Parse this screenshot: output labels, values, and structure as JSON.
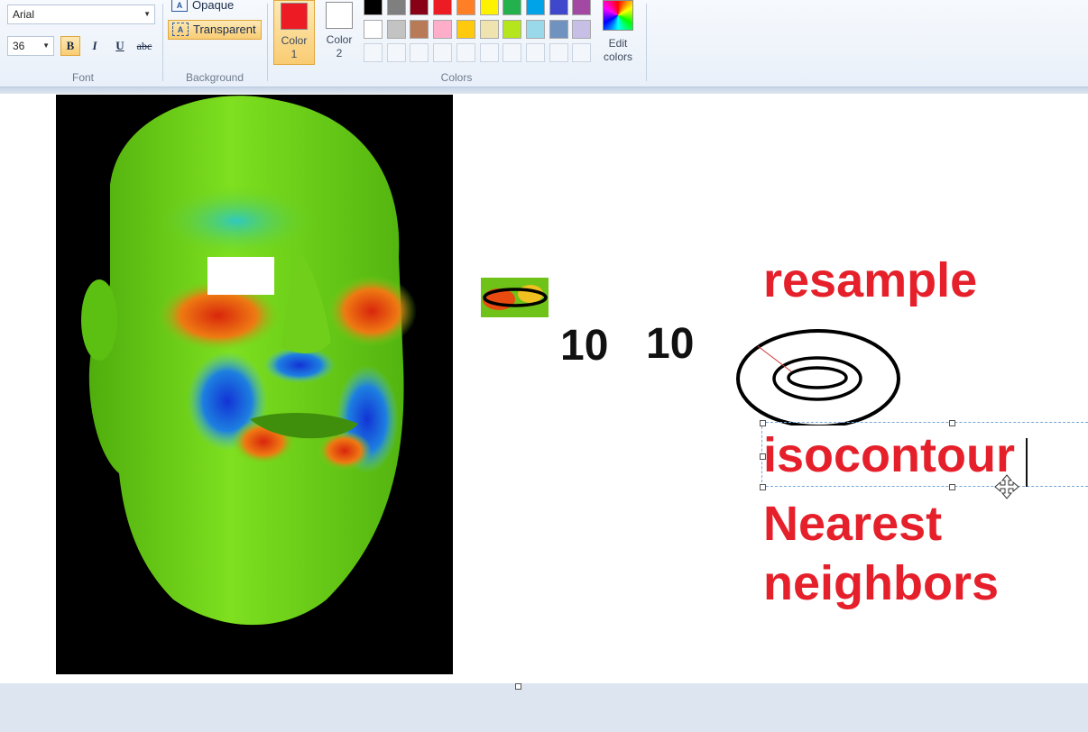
{
  "ribbon": {
    "font_group": {
      "font_name": "Arial",
      "font_size": "36",
      "bold_glyph": "B",
      "italic_glyph": "I",
      "underline_glyph": "U",
      "strike_glyph": "abc",
      "label": "Font"
    },
    "background_group": {
      "opaque_label": "Opaque",
      "transparent_label": "Transparent",
      "label": "Background"
    },
    "colors_group": {
      "color1_label": "Color",
      "color1_num": "1",
      "color1_value": "#ed1c24",
      "color2_label": "Color",
      "color2_num": "2",
      "color2_value": "#ffffff",
      "edit_label": "Edit",
      "edit_label2": "colors",
      "label": "Colors",
      "palette_row1": [
        "#000000",
        "#7f7f7f",
        "#880015",
        "#ed1c24",
        "#ff7f27",
        "#fff200",
        "#22b14c",
        "#00a2e8",
        "#3f48cc",
        "#a349a4"
      ],
      "palette_row2": [
        "#ffffff",
        "#c3c3c3",
        "#b97a57",
        "#ffaec9",
        "#ffc90e",
        "#efe4b0",
        "#b5e61d",
        "#99d9ea",
        "#7092be",
        "#c8bfe7"
      ]
    }
  },
  "canvas": {
    "text_ten_1": "10",
    "text_ten_2": "10",
    "label_resample": "resample",
    "label_isocontour": "isocontour",
    "label_nearest": "Nearest",
    "label_neighbors": "neighbors"
  }
}
